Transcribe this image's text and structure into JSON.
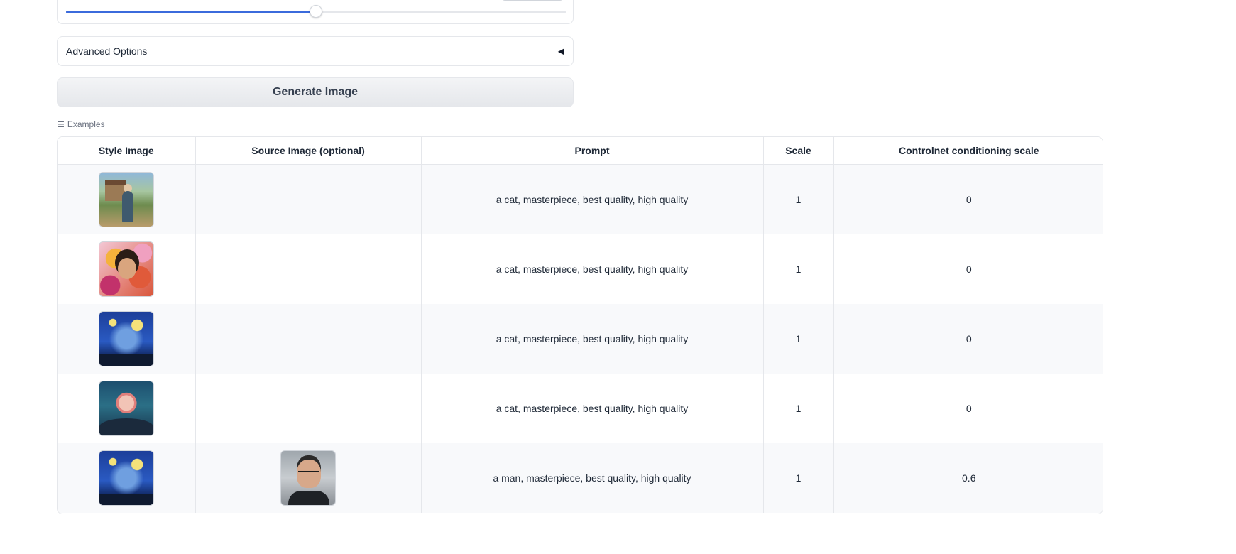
{
  "slider": {
    "progress_fraction": 0.5
  },
  "advanced_options": {
    "label": "Advanced Options",
    "caret_icon": "caret-left-icon",
    "caret_glyph": "◀"
  },
  "generate_button": {
    "label": "Generate Image"
  },
  "examples": {
    "label": "Examples",
    "icon": "list-icon",
    "icon_glyph": "☰",
    "columns": [
      "Style Image",
      "Source Image (optional)",
      "Prompt",
      "Scale",
      "Controlnet conditioning scale"
    ],
    "rows": [
      {
        "style_image": "village-figure-painting",
        "source_image": "",
        "prompt": "a cat, masterpiece, best quality, high quality",
        "scale": "1",
        "controlnet_scale": "0"
      },
      {
        "style_image": "girl-with-flowers",
        "source_image": "",
        "prompt": "a cat, masterpiece, best quality, high quality",
        "scale": "1",
        "controlnet_scale": "0"
      },
      {
        "style_image": "starry-night",
        "source_image": "",
        "prompt": "a cat, masterpiece, best quality, high quality",
        "scale": "1",
        "controlnet_scale": "0"
      },
      {
        "style_image": "pink-moon-night",
        "source_image": "",
        "prompt": "a cat, masterpiece, best quality, high quality",
        "scale": "1",
        "controlnet_scale": "0"
      },
      {
        "style_image": "starry-night",
        "source_image": "man-portrait-photo",
        "prompt": "a man, masterpiece, best quality, high quality",
        "scale": "1",
        "controlnet_scale": "0.6"
      }
    ]
  }
}
